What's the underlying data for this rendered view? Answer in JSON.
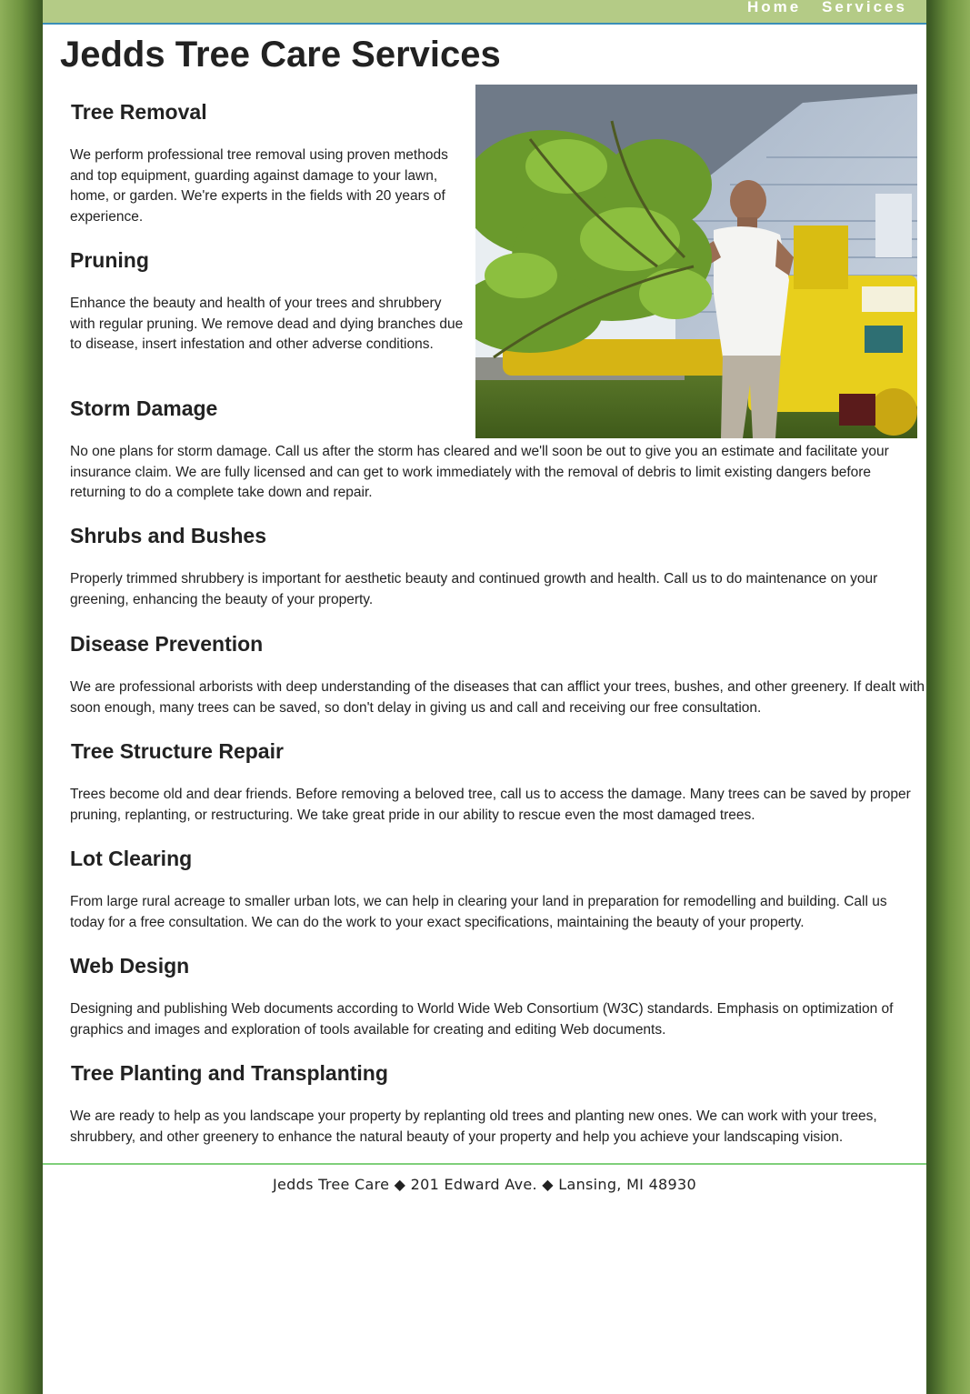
{
  "nav": {
    "home": "Home",
    "services": "Services"
  },
  "site_title": "Jedds Tree Care Services",
  "hero_image": {
    "alt": "Worker feeding branches into a yellow wood chipper"
  },
  "sections": [
    {
      "heading": "Tree Removal",
      "body": "We perform professional tree removal using proven methods and top equipment, guarding against damage to your lawn, home, or garden. We're experts in the fields with 20 years of experience."
    },
    {
      "heading": "Pruning",
      "body": "Enhance the beauty and health of your trees and shrubbery with regular pruning. We remove dead and dying branches due to disease, insert infestation and other adverse conditions."
    },
    {
      "heading": "Storm Damage",
      "body": "No one plans for storm damage. Call us after the storm has cleared and we'll soon be out to give you an estimate and facilitate your insurance claim. We are fully licensed and can get to work immediately with the removal of debris to limit existing dangers before returning to do a complete take down and repair."
    },
    {
      "heading": "Shrubs and Bushes",
      "body": "Properly trimmed shrubbery is important for aesthetic beauty and continued growth and health. Call us to do maintenance on your greening, enhancing the beauty of your property."
    },
    {
      "heading": "Disease Prevention",
      "body": "We are professional arborists with deep understanding of the diseases that can afflict your trees, bushes, and other greenery. If dealt with soon enough, many trees can be saved, so don't delay in giving us and call and receiving our free consultation."
    },
    {
      "heading": "Tree Structure Repair",
      "body": "Trees become old and dear friends. Before removing a beloved tree, call us to access the damage. Many trees can be saved by proper pruning, replanting, or restructuring. We take great pride in our ability to rescue even the most damaged trees."
    },
    {
      "heading": "Lot Clearing",
      "body": "From large rural acreage to smaller urban lots, we can help in clearing your land in preparation for remodelling and building. Call us today for a free consultation. We can do the work to your exact specifications, maintaining the beauty of your property."
    },
    {
      "heading": "Web Design",
      "body": "Designing and publishing Web documents according to World Wide Web Consortium (W3C) standards. Emphasis on optimization of graphics and images and exploration of tools available for creating and editing Web documents."
    },
    {
      "heading": "Tree Planting and Transplanting",
      "body": "We are ready to help as you landscape your property by replanting old trees and planting new ones. We can work with your trees, shrubbery, and other greenery to enhance the natural beauty of your property and help you achieve your landscaping vision."
    }
  ],
  "footer": {
    "text": "Jedds Tree Care ◆ 201 Edward Ave. ◆ Lansing, MI 48930"
  }
}
